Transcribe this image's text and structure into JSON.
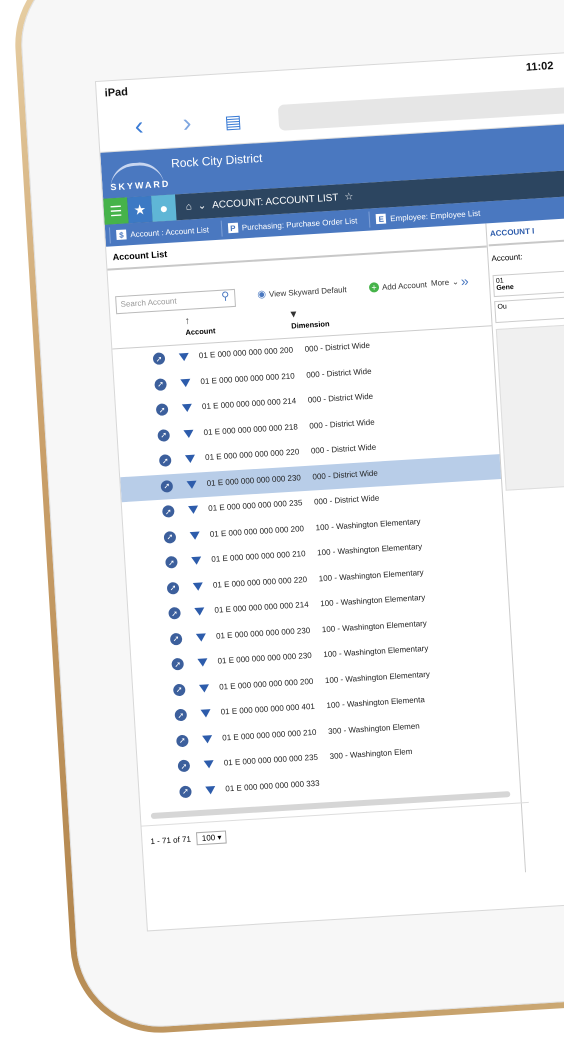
{
  "device": {
    "name": "iPad",
    "time": "11:02"
  },
  "browser": {
    "back": "‹",
    "forward": "›",
    "bookmarks": "bookmarks-icon"
  },
  "app": {
    "district": "Rock City District",
    "logo": "SKYWARD",
    "breadcrumb": "ACCOUNT: ACCOUNT LIST",
    "tabs": [
      {
        "label": "Account : Account List",
        "icon": "$"
      },
      {
        "label": "Purchasing: Purchase Order List",
        "icon": "P"
      },
      {
        "label": "Employee: Employee List",
        "icon": "E"
      }
    ]
  },
  "left": {
    "title": "Account List",
    "search_placeholder": "Search Account",
    "view_default": "View Skyward Default",
    "add_account": "Add Account",
    "more": "More",
    "col_account": "Account",
    "col_dimension": "Dimension",
    "rows": [
      {
        "account": "01 E 000 000 000 000 200",
        "dimension": "000 - District Wide",
        "selected": false
      },
      {
        "account": "01 E 000 000 000 000 210",
        "dimension": "000 - District Wide",
        "selected": false
      },
      {
        "account": "01 E 000 000 000 000 214",
        "dimension": "000 - District Wide",
        "selected": false
      },
      {
        "account": "01 E 000 000 000 000 218",
        "dimension": "000 - District Wide",
        "selected": false
      },
      {
        "account": "01 E 000 000 000 000 220",
        "dimension": "000 - District Wide",
        "selected": false
      },
      {
        "account": "01 E 000 000 000 000 230",
        "dimension": "000 - District Wide",
        "selected": true
      },
      {
        "account": "01 E 000 000 000 000 235",
        "dimension": "000 - District Wide",
        "selected": false
      },
      {
        "account": "01 E 000 000 000 000 200",
        "dimension": "100 - Washington Elementary",
        "selected": false
      },
      {
        "account": "01 E 000 000 000 000 210",
        "dimension": "100 - Washington Elementary",
        "selected": false
      },
      {
        "account": "01 E 000 000 000 000 220",
        "dimension": "100 - Washington Elementary",
        "selected": false
      },
      {
        "account": "01 E 000 000 000 000 214",
        "dimension": "100 - Washington Elementary",
        "selected": false
      },
      {
        "account": "01 E 000 000 000 000 230",
        "dimension": "100 - Washington Elementary",
        "selected": false
      },
      {
        "account": "01 E 000 000 000 000 230",
        "dimension": "100 - Washington Elementary",
        "selected": false
      },
      {
        "account": "01 E 000 000 000 000 200",
        "dimension": "100 - Washington Elementary",
        "selected": false
      },
      {
        "account": "01 E 000 000 000 000 401",
        "dimension": "100 - Washington Elementa",
        "selected": false
      },
      {
        "account": "01 E 000 000 000 000 210",
        "dimension": "300 - Washington Elemen",
        "selected": false
      },
      {
        "account": "01 E 000 000 000 000 235",
        "dimension": "300 - Washington Elem",
        "selected": false
      },
      {
        "account": "01 E 000 000 000 000 333",
        "dimension": "",
        "selected": false
      }
    ],
    "pager_text": "1 - 71 of 71",
    "page_size": "100"
  },
  "right": {
    "title": "ACCOUNT I",
    "account_label": "Account:",
    "field1_line1": "01",
    "field1_line2": "Gene",
    "field2": "Ou"
  }
}
